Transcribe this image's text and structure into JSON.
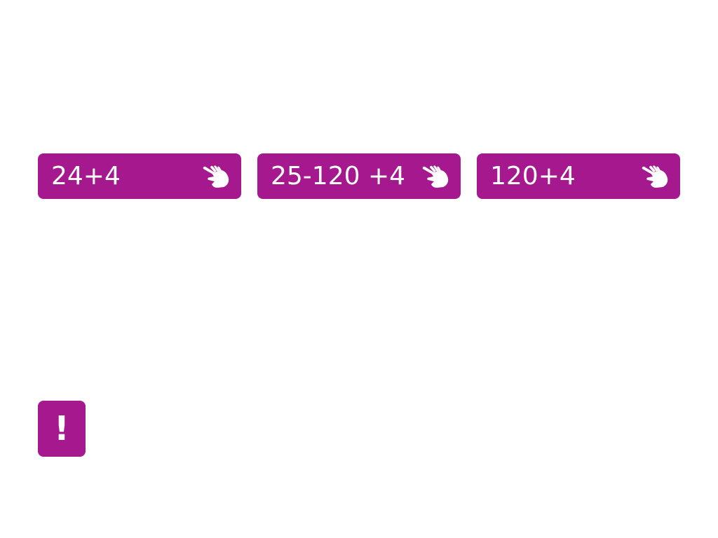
{
  "colors": {
    "accent": "#a6188e",
    "text_on_accent": "#ffffff",
    "background": "#ffffff"
  },
  "options": [
    {
      "label": "24+4",
      "icon": "pointing-hand-icon"
    },
    {
      "label": "25-120 +4",
      "icon": "pointing-hand-icon"
    },
    {
      "label": "120+4",
      "icon": "pointing-hand-icon"
    }
  ],
  "alert": {
    "glyph": "!",
    "icon": "exclamation-icon"
  }
}
